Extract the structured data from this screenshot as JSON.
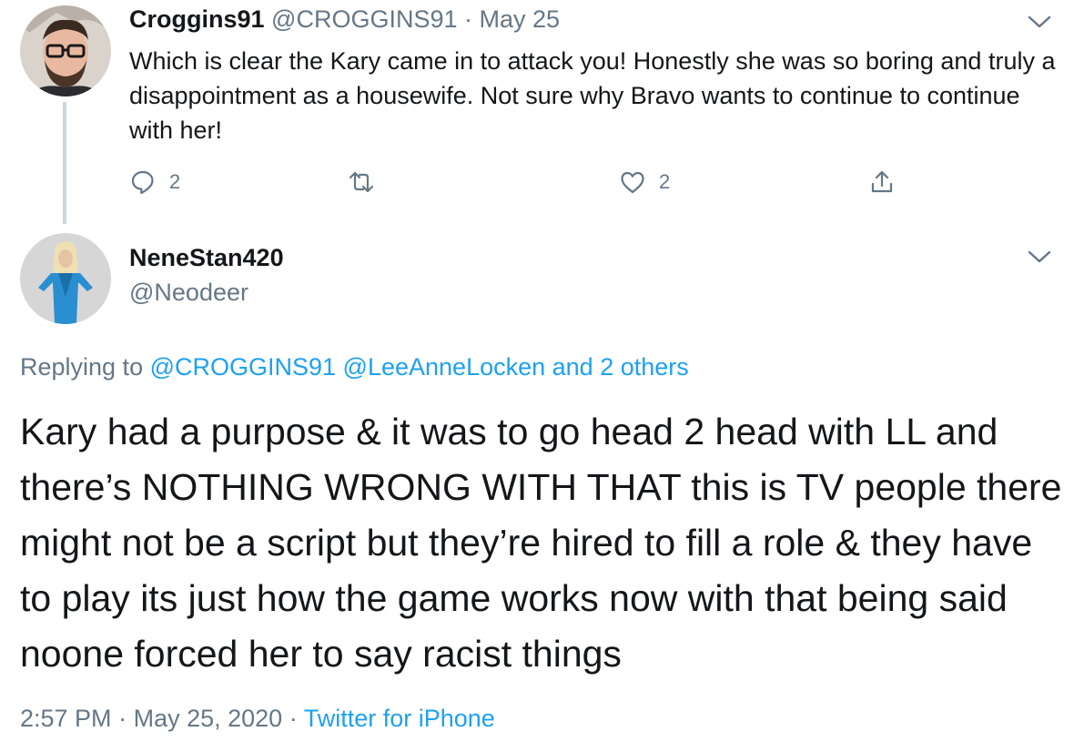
{
  "parent_tweet": {
    "display_name": "Croggins91",
    "handle": "@CROGGINS91",
    "separator": "·",
    "date": "May 25",
    "text": "Which is clear the Kary came in to attack you!  Honestly she was so boring and truly a disappointment as a housewife. Not sure why Bravo wants to continue to continue with her!",
    "reply_count": "2",
    "like_count": "2",
    "icons": [
      "avatar-man-glasses",
      "chevron-down-icon",
      "reply-icon",
      "retweet-icon",
      "like-icon",
      "share-icon"
    ]
  },
  "reply_tweet": {
    "display_name": "NeneStan420",
    "handle": "@Neodeer",
    "replying_prefix": "Replying to",
    "replying_users": "@CROGGINS91 @LeeAnneLocken and 2 others",
    "text": "Kary had a purpose & it was to go head 2 head with LL and there’s NOTHING WRONG WITH THAT this is TV people there might not be a script but they’re hired to fill a role & they have to play its just how the game works now with that being said noone forced her to say racist things",
    "time": "2:57 PM",
    "separator": "·",
    "date": "May 25, 2020",
    "source": "Twitter for iPhone"
  },
  "colors": {
    "text": "#14171a",
    "muted": "#657786",
    "link": "#1da1f2",
    "thread_line": "#ccd6dd"
  }
}
